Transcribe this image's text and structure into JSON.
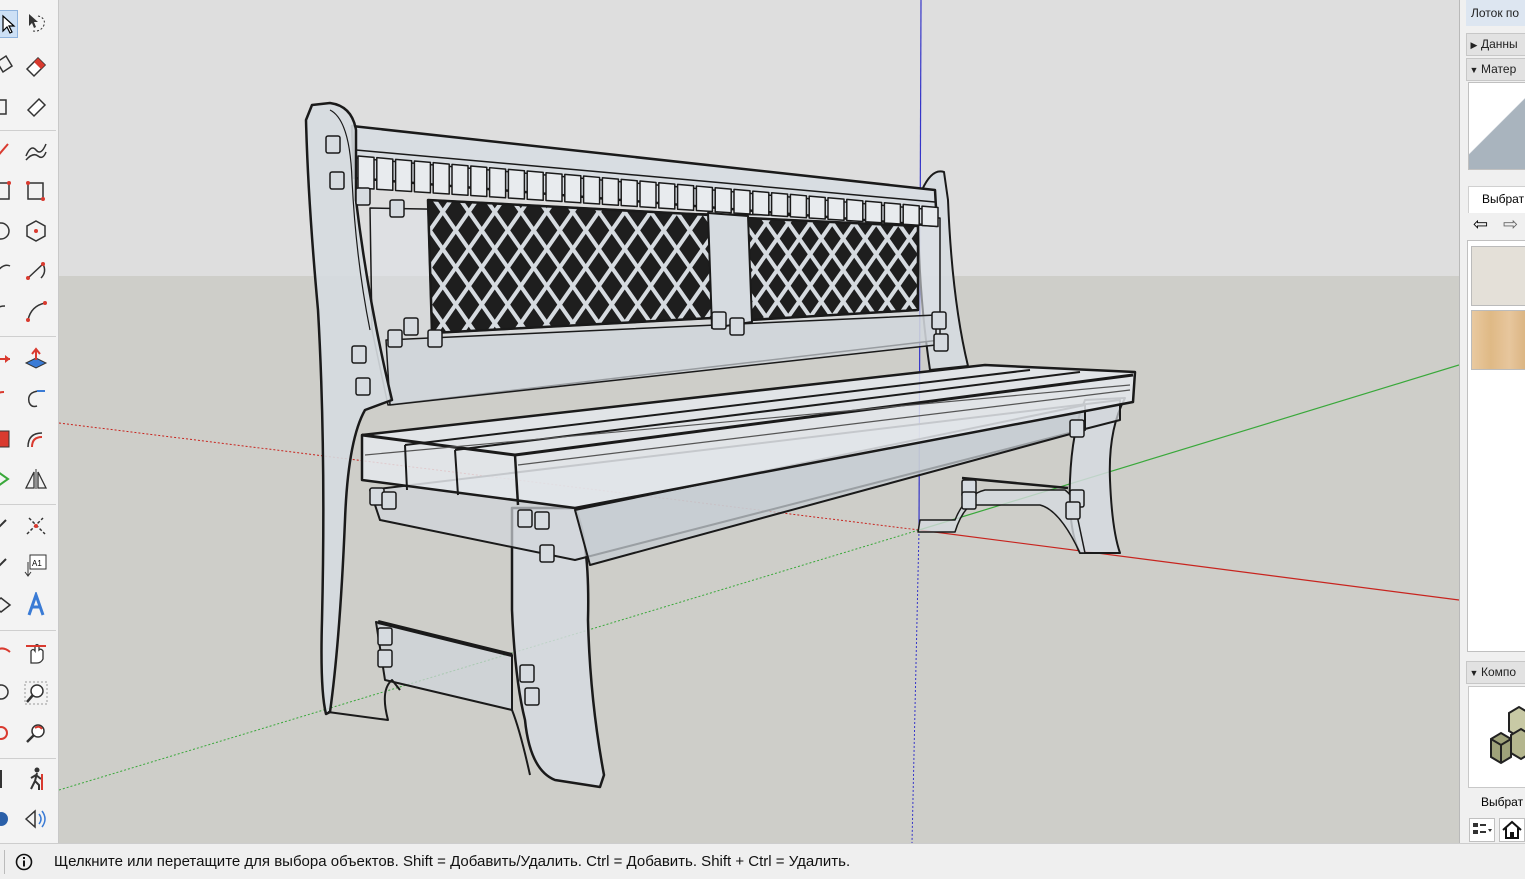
{
  "tray": {
    "title": "Лоток по",
    "panel_entity_info": "Данны",
    "panel_materials": "Матер",
    "materials_select_tab": "Выбрат",
    "panel_components": "Компо",
    "components_select_tab": "Выбрат"
  },
  "status": {
    "hint": "Щелкните или перетащите для выбора объектов. Shift = Добавить/Удалить. Ctrl = Добавить. Shift + Ctrl = Удалить."
  },
  "colors": {
    "sky": "#dedede",
    "ground": "#cecec9",
    "axis_red": "#c8241e",
    "axis_green": "#39a83a",
    "axis_blue": "#3535c8",
    "tray_title_bg": "#dde6f1"
  },
  "icons": {
    "tools": [
      "select-icon",
      "lasso-select-icon",
      "paint-bucket-icon",
      "eraser-icon",
      "tag-icon",
      "eraser-shape-icon",
      "line-icon",
      "freehand-icon",
      "rectangle-icon",
      "rotated-rectangle-icon",
      "circle-icon",
      "polygon-icon",
      "arc-icon",
      "pie-arc-icon",
      "arc-2pt-icon",
      "arc-3pt-icon",
      "move-icon",
      "push-pull-icon",
      "rotate-icon",
      "follow-me-icon",
      "scale-icon",
      "offset-icon",
      "section-icon",
      "mirror-icon",
      "tape-measure-icon",
      "axes-icon",
      "dimension-icon",
      "text-label-icon",
      "protractor-icon",
      "3d-text-icon",
      "orbit-icon",
      "pan-icon",
      "zoom-window-icon",
      "zoom-icon",
      "zoom-extents-icon",
      "previous-view-icon",
      "position-camera-icon",
      "walk-icon",
      "look-around-icon",
      "section-plane-icon"
    ],
    "status_info": "info-icon"
  }
}
